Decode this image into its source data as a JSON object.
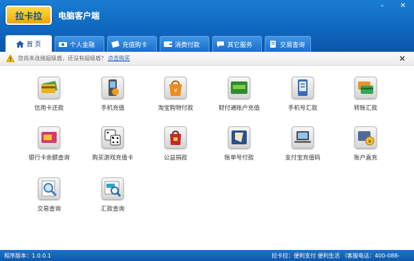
{
  "app": {
    "logo_text": "拉卡拉",
    "title": "电脑客户端",
    "min_symbol": "–",
    "close_symbol": "✕"
  },
  "tabs": [
    {
      "label": "首 页",
      "icon": "home-icon",
      "active": true
    },
    {
      "label": "个人金融",
      "icon": "money-icon",
      "active": false
    },
    {
      "label": "充值购卡",
      "icon": "card-icon",
      "active": false
    },
    {
      "label": "消费付款",
      "icon": "wallet-icon",
      "active": false
    },
    {
      "label": "其它服务",
      "icon": "chat-icon",
      "active": false
    },
    {
      "label": "交易查询",
      "icon": "document-icon",
      "active": false
    }
  ],
  "notice": {
    "text": "您尚未连接超级盾，还没有超级盾？",
    "link": "点击购买",
    "close": "✕"
  },
  "services": [
    {
      "label": "信用卡还款",
      "icon": "credit-card-icon",
      "color": "#4aa64c"
    },
    {
      "label": "手机充值",
      "icon": "mobile-phone-icon",
      "color": "#d9d9d9"
    },
    {
      "label": "淘宝购物付款",
      "icon": "taobao-bag-icon",
      "color": "#ef8a1c"
    },
    {
      "label": "财付通账户充值",
      "icon": "tenpay-icon",
      "color": "#2f8a2f"
    },
    {
      "label": "手机号汇款",
      "icon": "mobile-transfer-icon",
      "color": "#3a6bb8"
    },
    {
      "label": "转账汇款",
      "icon": "transfer-icon",
      "color": "#e8952a"
    },
    {
      "label": "银行卡余额查询",
      "icon": "card-balance-icon",
      "color": "#d53a6e"
    },
    {
      "label": "购买游戏充值卡",
      "icon": "game-dice-icon",
      "color": "#e6e6e6"
    },
    {
      "label": "公益捐款",
      "icon": "donation-bag-icon",
      "color": "#c8262e"
    },
    {
      "label": "账单号付款",
      "icon": "bill-pay-icon",
      "color": "#2a4f8f"
    },
    {
      "label": "支付宝充值码",
      "icon": "alipay-laptop-icon",
      "color": "#4a4a4a"
    },
    {
      "label": "账户直充",
      "icon": "account-topup-icon",
      "color": "#4d6b9a"
    },
    {
      "label": "交易查询",
      "icon": "search-magnifier-icon",
      "color": "#6fa8d8"
    },
    {
      "label": "汇款查询",
      "icon": "remit-search-icon",
      "color": "#2aa8c8"
    }
  ],
  "status": {
    "version": "程序版本：1.0.0.1",
    "slogan": "拉卡拉：便利支付 便利生活 （客服电话：400-088-1234）"
  }
}
